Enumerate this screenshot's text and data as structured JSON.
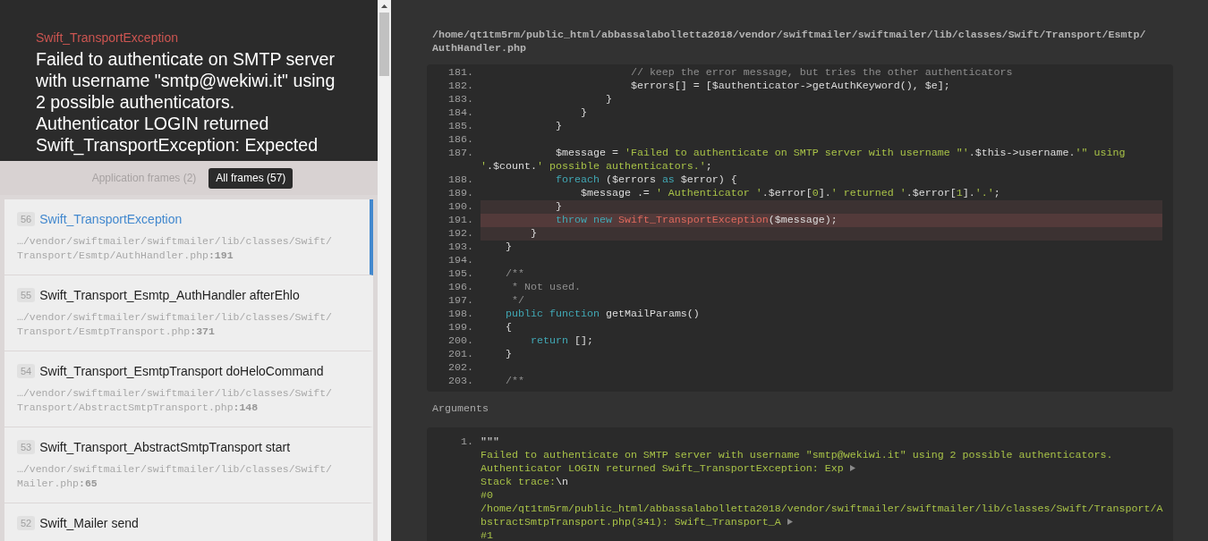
{
  "exception": {
    "class": "Swift_TransportException",
    "message": "Failed to authenticate on SMTP server with username \"smtp@wekiwi.it\" using 2 possible authenticators. Authenticator LOGIN returned Swift_TransportException: Expected"
  },
  "frames": {
    "tabs": [
      {
        "label": "Application frames (2)",
        "selected": false
      },
      {
        "label": "All frames (57)",
        "selected": true
      }
    ],
    "items": [
      {
        "index": "56",
        "title": "Swift_TransportException",
        "file": "…/vendor/swiftmailer/swiftmailer/lib/classes/Swift/Transport/Esmtp/AuthHandler.php**:191**",
        "selected": true
      },
      {
        "index": "55",
        "title": "Swift_Transport_Esmtp_AuthHandler afterEhlo",
        "file": "…/vendor/swiftmailer/swiftmailer/lib/classes/Swift/Transport/EsmtpTransport.php**:371**",
        "selected": false
      },
      {
        "index": "54",
        "title": "Swift_Transport_EsmtpTransport doHeloCommand",
        "file": "…/vendor/swiftmailer/swiftmailer/lib/classes/Swift/Transport/AbstractSmtpTransport.php**:148**",
        "selected": false
      },
      {
        "index": "53",
        "title": "Swift_Transport_AbstractSmtpTransport start",
        "file": "…/vendor/swiftmailer/swiftmailer/lib/classes/Swift/Mailer.php**:65**",
        "selected": false
      },
      {
        "index": "52",
        "title": "Swift_Mailer send",
        "selected": false
      }
    ]
  },
  "code": {
    "file": "/home/qt1tm5rm/public_html/abbassalabolletta2018/vendor/swiftmailer/swiftmailer/lib/classes/Swift/Transport/Esmtp/AuthHandler.php",
    "lines": [
      {
        "number": "181.",
        "highlighted": false,
        "current": false,
        "segments": [
          {
            "kind": "comment",
            "text": "                        // keep the error message, but tries the other authenticators"
          }
        ]
      },
      {
        "number": "182.",
        "highlighted": false,
        "current": false,
        "segments": [
          {
            "kind": "plain",
            "text": "                        $errors[] = [$authenticator->getAuthKeyword(), $e];"
          }
        ]
      },
      {
        "number": "183.",
        "highlighted": false,
        "current": false,
        "segments": [
          {
            "kind": "plain",
            "text": "                    }"
          }
        ]
      },
      {
        "number": "184.",
        "highlighted": false,
        "current": false,
        "segments": [
          {
            "kind": "plain",
            "text": "                }"
          }
        ]
      },
      {
        "number": "185.",
        "highlighted": false,
        "current": false,
        "segments": [
          {
            "kind": "plain",
            "text": "            }"
          }
        ]
      },
      {
        "number": "186.",
        "highlighted": false,
        "current": false
      },
      {
        "number": "187.",
        "highlighted": false,
        "current": false,
        "segments": [
          {
            "kind": "plain",
            "text": "            $message = "
          },
          {
            "kind": "string",
            "text": "'Failed to authenticate on SMTP server with username \"'"
          },
          {
            "kind": "plain",
            "text": ".$this->username."
          },
          {
            "kind": "string",
            "text": "'\" using '"
          },
          {
            "kind": "plain",
            "text": ".$count."
          },
          {
            "kind": "string",
            "text": "' possible authenticators.'"
          },
          {
            "kind": "plain",
            "text": ";"
          }
        ]
      },
      {
        "number": "188.",
        "highlighted": false,
        "current": false,
        "segments": [
          {
            "kind": "keyword",
            "text": "            foreach"
          },
          {
            "kind": "plain",
            "text": " ($errors "
          },
          {
            "kind": "keyword",
            "text": "as"
          },
          {
            "kind": "plain",
            "text": " $error) {"
          }
        ]
      },
      {
        "number": "189.",
        "highlighted": false,
        "current": false,
        "segments": [
          {
            "kind": "plain",
            "text": "                $message .= "
          },
          {
            "kind": "string",
            "text": "' Authenticator '"
          },
          {
            "kind": "plain",
            "text": ".$error["
          },
          {
            "kind": "number",
            "text": "0"
          },
          {
            "kind": "plain",
            "text": "]."
          },
          {
            "kind": "string",
            "text": "' returned '"
          },
          {
            "kind": "plain",
            "text": ".$error["
          },
          {
            "kind": "number",
            "text": "1"
          },
          {
            "kind": "plain",
            "text": "]."
          },
          {
            "kind": "string",
            "text": "'.'"
          },
          {
            "kind": "plain",
            "text": ";"
          }
        ]
      },
      {
        "number": "190.",
        "highlighted": true,
        "current": false,
        "segments": [
          {
            "kind": "plain",
            "text": "            }"
          }
        ]
      },
      {
        "number": "191.",
        "highlighted": true,
        "current": true,
        "segments": [
          {
            "kind": "keyword",
            "text": "            throw"
          },
          {
            "kind": "keyword",
            "text": " new"
          },
          {
            "kind": "class",
            "text": " Swift_TransportException"
          },
          {
            "kind": "plain",
            "text": "($message);"
          }
        ]
      },
      {
        "number": "192.",
        "highlighted": true,
        "current": false,
        "segments": [
          {
            "kind": "plain",
            "text": "        }"
          }
        ]
      },
      {
        "number": "193.",
        "highlighted": false,
        "current": false,
        "segments": [
          {
            "kind": "plain",
            "text": "    }"
          }
        ]
      },
      {
        "number": "194.",
        "highlighted": false,
        "current": false
      },
      {
        "number": "195.",
        "highlighted": false,
        "current": false,
        "segments": [
          {
            "kind": "comment",
            "text": "    /**"
          }
        ]
      },
      {
        "number": "196.",
        "highlighted": false,
        "current": false,
        "segments": [
          {
            "kind": "comment",
            "text": "     * Not used."
          }
        ]
      },
      {
        "number": "197.",
        "highlighted": false,
        "current": false,
        "segments": [
          {
            "kind": "comment",
            "text": "     */"
          }
        ]
      },
      {
        "number": "198.",
        "highlighted": false,
        "current": false,
        "segments": [
          {
            "kind": "keyword",
            "text": "    public"
          },
          {
            "kind": "keyword",
            "text": " function"
          },
          {
            "kind": "plain",
            "text": " getMailParams()"
          }
        ]
      },
      {
        "number": "199.",
        "highlighted": false,
        "current": false,
        "segments": [
          {
            "kind": "plain",
            "text": "    {"
          }
        ]
      },
      {
        "number": "200.",
        "highlighted": false,
        "current": false,
        "segments": [
          {
            "kind": "keyword",
            "text": "        return"
          },
          {
            "kind": "plain",
            "text": " [];"
          }
        ]
      },
      {
        "number": "201.",
        "highlighted": false,
        "current": false,
        "segments": [
          {
            "kind": "plain",
            "text": "    }"
          }
        ]
      },
      {
        "number": "202.",
        "highlighted": false,
        "current": false
      },
      {
        "number": "203.",
        "highlighted": false,
        "current": false,
        "segments": [
          {
            "kind": "comment",
            "text": "    /**"
          }
        ]
      }
    ]
  },
  "arguments": {
    "heading": "Arguments",
    "items": [
      {
        "number": "1.",
        "lines": [
          {
            "segments": [
              {
                "kind": "plain",
                "text": "\"\"\""
              }
            ],
            "truncated": false
          },
          {
            "segments": [
              {
                "kind": "string",
                "text": "Failed to authenticate on SMTP server with username \"smtp@wekiwi.it\" using 2 possible authenticators."
              }
            ],
            "truncated": false
          },
          {
            "segments": [
              {
                "kind": "string",
                "text": "Authenticator LOGIN returned Swift_TransportException: Exp"
              }
            ],
            "truncated": true
          },
          {
            "segments": [
              {
                "kind": "string",
                "text": "Stack trace:"
              },
              {
                "kind": "plain",
                "text": "\\n"
              }
            ],
            "truncated": false
          },
          {
            "segments": [
              {
                "kind": "string",
                "text": "#0"
              }
            ],
            "truncated": false
          },
          {
            "segments": [
              {
                "kind": "string",
                "text": "/home/qt1tm5rm/public_html/abbassalabolletta2018/vendor/swiftmailer/swiftmailer/lib/classes/Swift/Transport/A"
              }
            ],
            "truncated": false
          },
          {
            "segments": [
              {
                "kind": "string",
                "text": "bstractSmtpTransport.php(341): Swift_Transport_A"
              }
            ],
            "truncated": true
          },
          {
            "segments": [
              {
                "kind": "string",
                "text": "#1"
              }
            ],
            "truncated": false
          }
        ]
      }
    ]
  }
}
